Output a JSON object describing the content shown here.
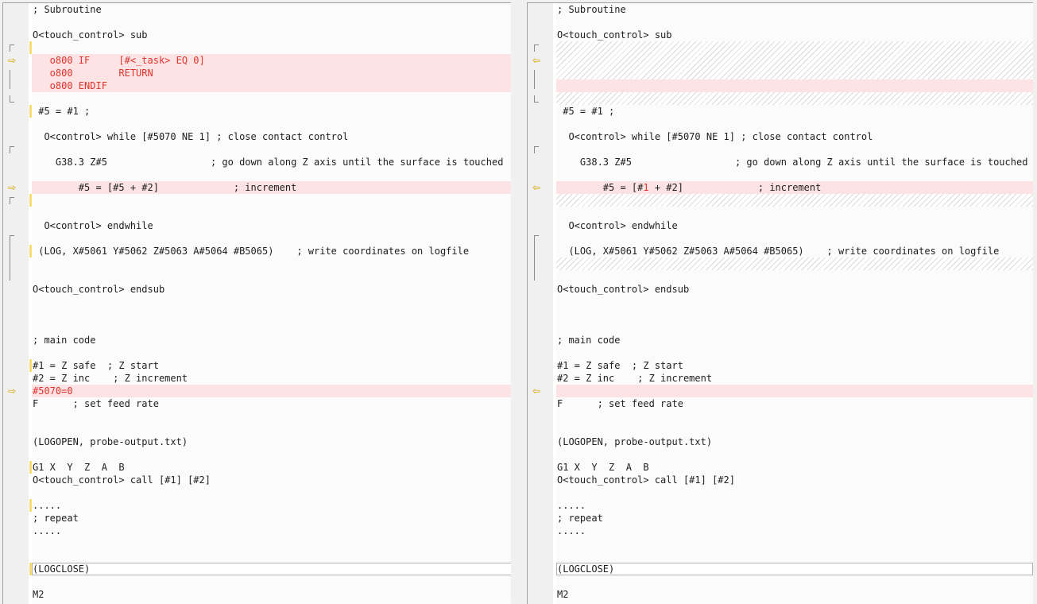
{
  "left_pane": {
    "lines": {
      "l0": "; Subroutine",
      "l2": "O<touch_control> sub",
      "l4": "   o800 IF     [#<_task> EQ 0]",
      "l5": "   o800        RETURN",
      "l6": "   o800 ENDIF",
      "l8": " #5 = #1 ;",
      "l10": "  O<control> while [#5070 NE 1] ; close contact control",
      "l12": "    G38.3 Z#5                  ; go down along Z axis until the surface is touched",
      "l14": "        #5 = [#5 + #2]             ; increment",
      "l17": "  O<control> endwhile",
      "l19": " (LOG, X#5061 Y#5062 Z#5063 A#5064 #B5065)    ; write coordinates on logfile",
      "l22": "O<touch_control> endsub",
      "l26": "; main code",
      "l28": "#1 = Z safe  ; Z start",
      "l29": "#2 = Z inc    ; Z increment",
      "l30": "#5070=0",
      "l31": "F      ; set feed rate",
      "l34": "(LOGOPEN, probe-output.txt)",
      "l36": "G1 X  Y  Z  A  B",
      "l37": "O<touch_control> call [#1] [#2]",
      "l39": ".....",
      "l40": "; repeat",
      "l41": ".....",
      "l44": "(LOGCLOSE)",
      "l46": "M2"
    }
  },
  "right_pane": {
    "lines": {
      "l0": "; Subroutine",
      "l2": "O<touch_control> sub",
      "l8": " #5 = #1 ;",
      "l10": "  O<control> while [#5070 NE 1] ; close contact control",
      "l12": "    G38.3 Z#5                  ; go down along Z axis until the surface is touched",
      "l14_a": "        #5 = [#",
      "l14_b": "1",
      "l14_c": " + #2]             ; increment",
      "l17": "  O<control> endwhile",
      "l19": "  (LOG, X#5061 Y#5062 Z#5063 A#5064 #B5065)    ; write coordinates on logfile",
      "l22": "O<touch_control> endsub",
      "l26": "; main code",
      "l28": "#1 = Z safe  ; Z start",
      "l29": "#2 = Z inc    ; Z increment",
      "l31": "F      ; set feed rate",
      "l34": "(LOGOPEN, probe-output.txt)",
      "l36": "G1 X  Y  Z  A  B",
      "l37": "O<touch_control> call [#1] [#2]",
      "l39": ".....",
      "l40": "; repeat",
      "l41": ".....",
      "l44": "(LOGCLOSE)",
      "l46": "M2"
    }
  },
  "icons": {
    "copy_arrow_left": "arrow-right-icon",
    "copy_arrow_right": "arrow-left-icon"
  },
  "colors": {
    "diff_bg": "#fde3e3",
    "diff_text": "#e2342e",
    "marker": "#f7de75"
  }
}
